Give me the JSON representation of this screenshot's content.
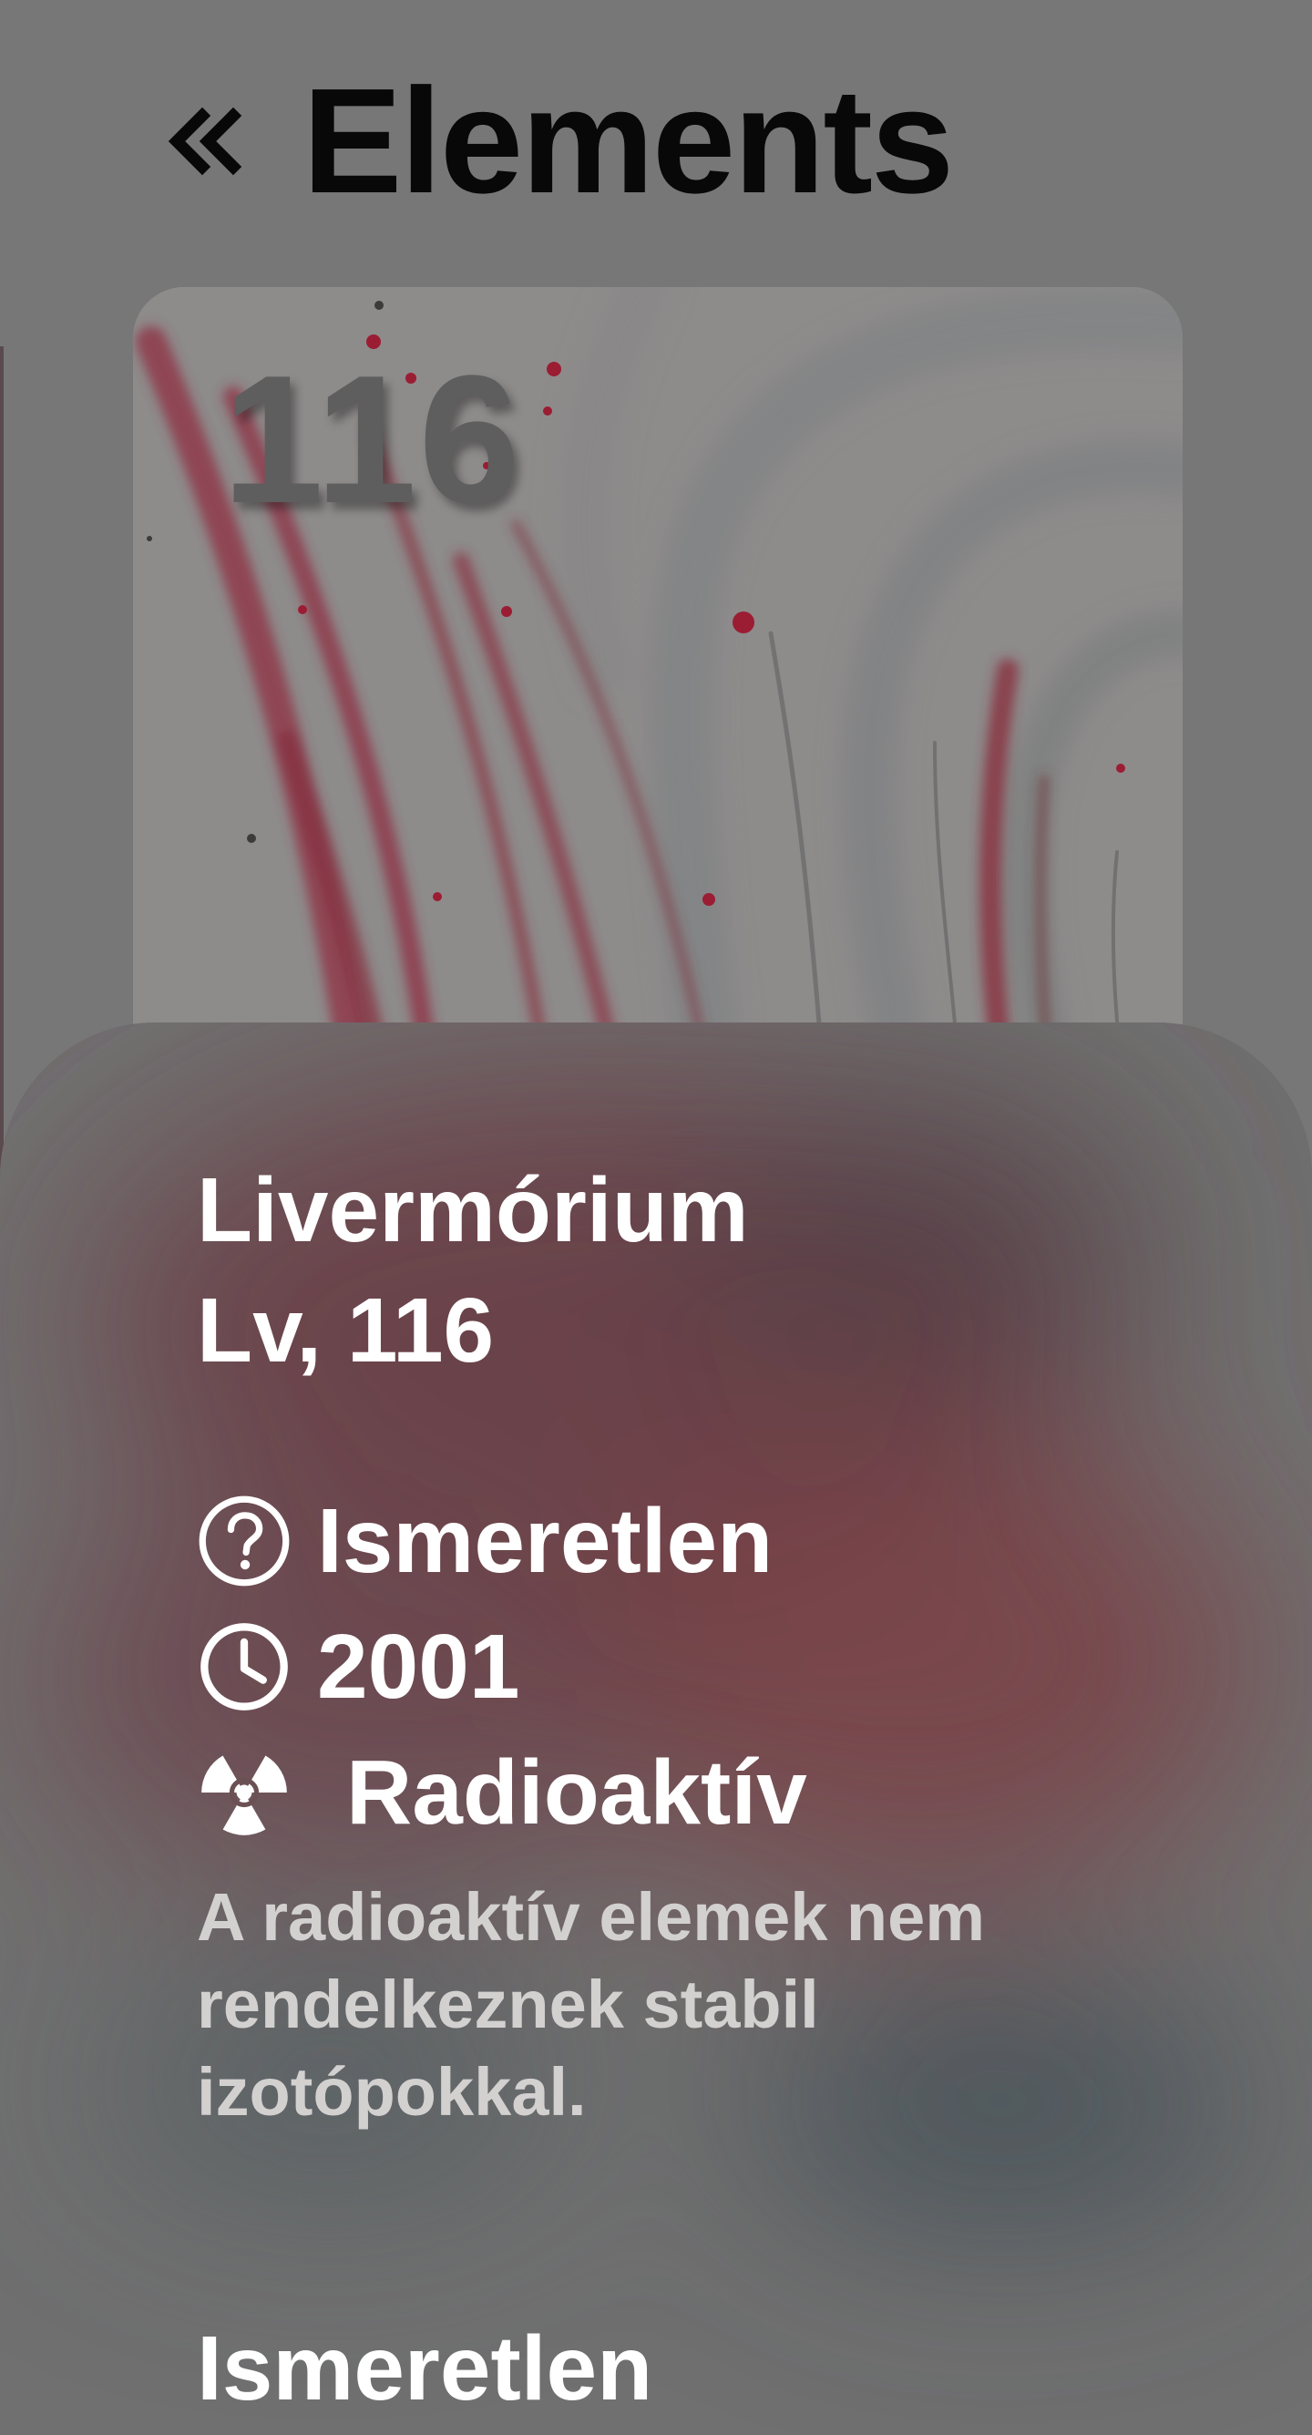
{
  "header": {
    "title": "Elements",
    "back_icon": "double-chevron-left-icon"
  },
  "card": {
    "number": "116"
  },
  "element": {
    "name": "Livermórium",
    "symbol_line": "Lv, 116",
    "info": [
      {
        "icon": "question-circle-icon",
        "text": "Ismeretlen"
      },
      {
        "icon": "clock-icon",
        "text": "2001"
      },
      {
        "icon": "radiation-icon",
        "text": "Radioaktív"
      }
    ],
    "description": "A radioaktív elemek nem rendelkeznek stabil izotópokkal.",
    "section_heading": "Ismeretlen"
  },
  "colors": {
    "overlay_gray": "#777777",
    "title_text": "#080808",
    "sheet_text": "#ffffff",
    "description_text": "#d3d0d0",
    "accent_red": "#c22244"
  }
}
